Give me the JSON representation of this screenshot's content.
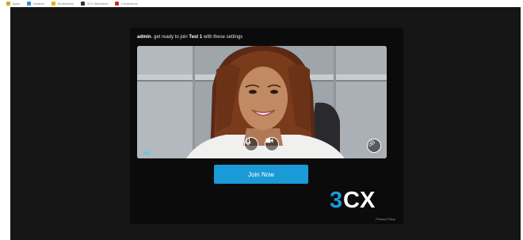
{
  "bookmarks": [
    {
      "label": "Apps",
      "color": "#d9a520"
    },
    {
      "label": "Intranet",
      "color": "#3b8ad9"
    },
    {
      "label": "Bookmarks",
      "color": "#e8b400"
    },
    {
      "label": "3CX Webclient",
      "color": "#2e2e2e"
    },
    {
      "label": "Conference",
      "color": "#cc2a2a"
    }
  ],
  "join_prompt": {
    "user": "admin",
    "middle": ". get ready to join ",
    "meeting": "Test 1",
    "suffix": " with these settings"
  },
  "controls": {
    "microphone_icon": "microphone-icon",
    "camera_icon": "video-camera-icon",
    "settings_icon": "gear-icon"
  },
  "join_button": {
    "label": "Join Now"
  },
  "logo": {
    "text_3": "3",
    "text_cx": "CX",
    "accent_color": "#1a9ad6"
  },
  "privacy_link": "Privacy Policy",
  "colors": {
    "page_bg": "#161616",
    "card_bg": "#0b0b0b",
    "primary": "#1a9ad6"
  }
}
